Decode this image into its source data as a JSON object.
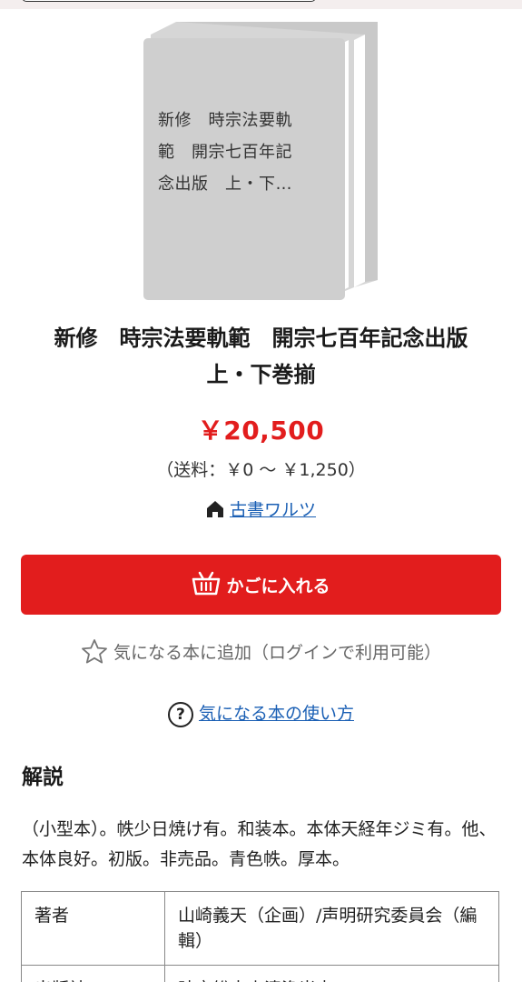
{
  "book_cover": {
    "title_lines": [
      "新修　時宗法要軌",
      "範　開宗七百年記",
      "念出版　上・下…"
    ]
  },
  "product": {
    "title_line1": "新修　時宗法要軌範　開宗七百年記念出版",
    "title_line2": "上・下巻揃",
    "price": "￥20,500",
    "shipping": "（送料：￥0 〜 ￥1,250）",
    "seller": "古書ワルツ"
  },
  "actions": {
    "add_to_cart": "かごに入れる",
    "favorite": "気になる本に追加（ログインで利用可能）",
    "howto": "気になる本の使い方"
  },
  "description": {
    "heading": "解説",
    "text": "（小型本）。帙少日焼け有。和装本。本体天経年ジミ有。他、本体良好。初版。非売品。青色帙。厚本。"
  },
  "specs": {
    "rows": [
      {
        "key": "著者",
        "value": "山崎義天（企画）/声明研究委員会（編輯）"
      },
      {
        "key": "出版社",
        "value": "時宗総本山清浄光寺"
      }
    ]
  },
  "colors": {
    "accent": "#e21d1d",
    "link": "#1a5fb4",
    "cover": "#cfcfcf"
  },
  "icons": [
    "home-icon",
    "basket-icon",
    "star-icon",
    "question-icon"
  ]
}
